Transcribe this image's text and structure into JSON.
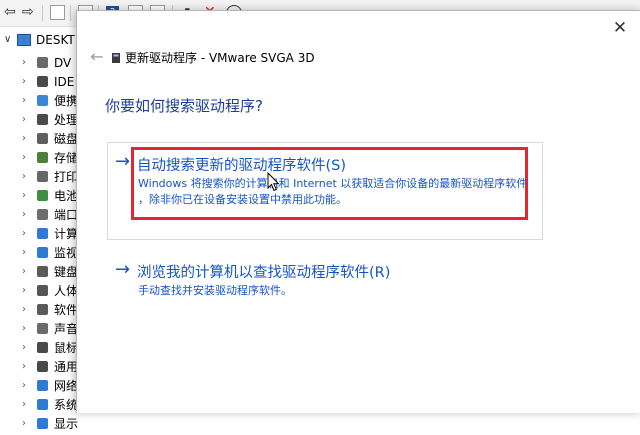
{
  "device_manager": {
    "toolbar_icons": [
      "back-arrow-icon",
      "forward-arrow-icon",
      "properties-icon",
      "help-icon",
      "scan-icon",
      "update-driver-icon",
      "disable-icon",
      "uninstall-icon",
      "download-icon"
    ],
    "tree": {
      "root_label": "DESKT",
      "items": [
        {
          "label": "DV",
          "icon": "dvd-drive-icon",
          "color": "#6a6a6a"
        },
        {
          "label": "IDE",
          "icon": "ide-controller-icon",
          "color": "#4a4a4a"
        },
        {
          "label": "便携",
          "icon": "portable-device-icon",
          "color": "#3a86d6"
        },
        {
          "label": "处理",
          "icon": "processor-icon",
          "color": "#4a4a4a"
        },
        {
          "label": "磁盘",
          "icon": "disk-drive-icon",
          "color": "#5e5e5e"
        },
        {
          "label": "存储",
          "icon": "storage-controller-icon",
          "color": "#4b7f3a"
        },
        {
          "label": "打印",
          "icon": "printer-icon",
          "color": "#666666"
        },
        {
          "label": "电池",
          "icon": "battery-icon",
          "color": "#3f8f3f"
        },
        {
          "label": "端口",
          "icon": "port-icon",
          "color": "#6d6d6d"
        },
        {
          "label": "计算",
          "icon": "computer-icon",
          "color": "#2e7bd3"
        },
        {
          "label": "监视",
          "icon": "monitor-icon",
          "color": "#2e7bd3"
        },
        {
          "label": "键盘",
          "icon": "keyboard-icon",
          "color": "#5a5a5a"
        },
        {
          "label": "人体",
          "icon": "human-interface-icon",
          "color": "#555555"
        },
        {
          "label": "软件",
          "icon": "software-device-icon",
          "color": "#5a5a5a"
        },
        {
          "label": "声音",
          "icon": "sound-icon",
          "color": "#6a6a6a"
        },
        {
          "label": "鼠标",
          "icon": "mouse-icon",
          "color": "#4a4a4a"
        },
        {
          "label": "通用",
          "icon": "usb-icon",
          "color": "#4a4a4a"
        },
        {
          "label": "网络",
          "icon": "network-icon",
          "color": "#2e7bd3"
        },
        {
          "label": "系统",
          "icon": "system-device-icon",
          "color": "#2e7bd3"
        },
        {
          "label": "显示",
          "icon": "display-adapter-icon",
          "color": "#2e7bd3"
        }
      ]
    }
  },
  "wizard": {
    "title": "更新驱动程序 - VMware SVGA 3D",
    "heading": "你要如何搜索驱动程序?",
    "option_auto": {
      "title": "自动搜索更新的驱动程序软件(S)",
      "desc_line1": "Windows 将搜索你的计算机和 Internet 以获取适合你设备的最新驱动程序软件",
      "desc_line2": "，除非你已在设备安装设置中禁用此功能。"
    },
    "option_browse": {
      "title": "浏览我的计算机以查找驱动程序软件(R)",
      "desc": "手动查找并安装驱动程序软件。"
    },
    "close_glyph": "✕",
    "back_glyph": "←",
    "arrow_glyph": "→"
  },
  "colors": {
    "link_blue": "#1554c7",
    "heading_blue": "#1e3c9c",
    "highlight_red": "#e5252f"
  }
}
